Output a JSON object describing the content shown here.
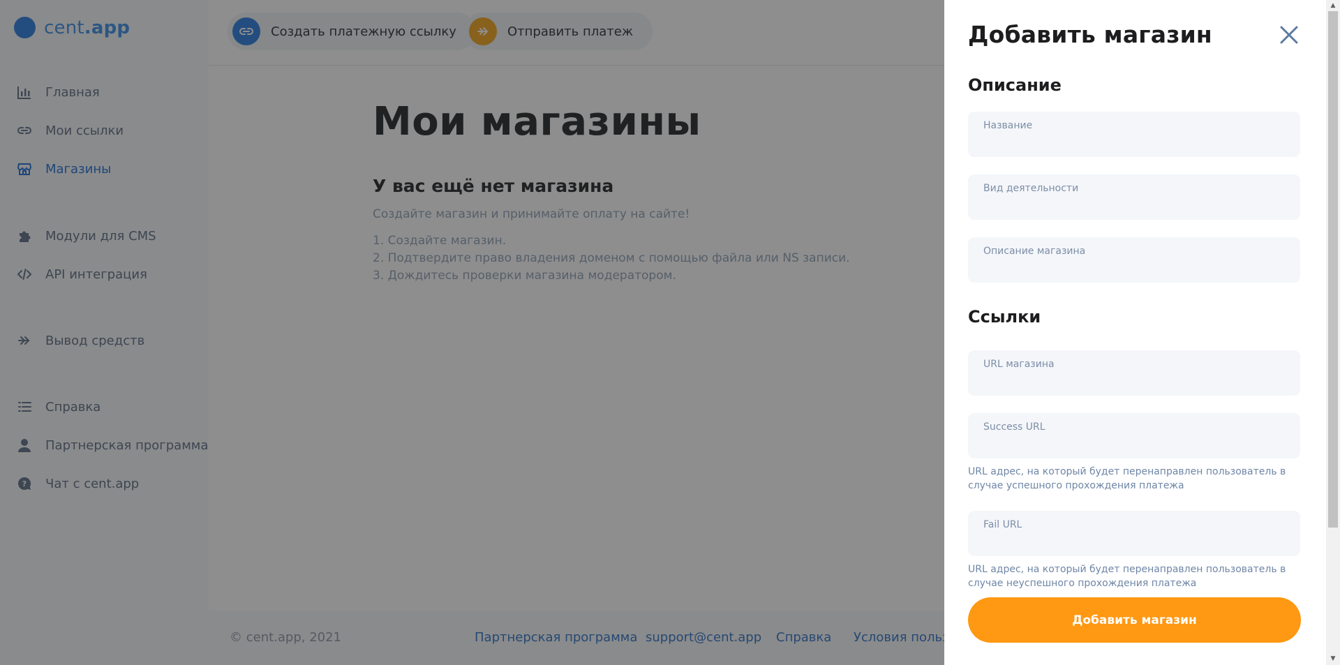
{
  "app": {
    "logo_name": "cent",
    "logo_tld": ".app"
  },
  "sidebar": {
    "items": [
      {
        "label": "Главная",
        "icon": "bar-chart-icon"
      },
      {
        "label": "Мои ссылки",
        "icon": "link-icon"
      },
      {
        "label": "Магазины",
        "icon": "store-icon",
        "active": true
      },
      {
        "label": "Модули для CMS",
        "icon": "puzzle-icon"
      },
      {
        "label": "API интеграция",
        "icon": "code-icon"
      },
      {
        "label": "Вывод средств",
        "icon": "double-arrow-icon"
      },
      {
        "label": "Справка",
        "icon": "list-icon"
      },
      {
        "label": "Партнерская программа",
        "icon": "user-icon"
      },
      {
        "label": "Чат с cent.app",
        "icon": "help-chat-icon"
      }
    ]
  },
  "topbar": {
    "create_link_label": "Создать платежную ссылку",
    "send_payment_label": "Отправить платеж"
  },
  "main": {
    "title": "Мои магазины",
    "empty_title": "У вас ещё нет магазина",
    "empty_subtitle": "Создайте магазин и принимайте оплату на сайте!",
    "steps": [
      "1. Создайте магазин.",
      "2. Подтвердите право владения доменом с помощью файла или NS записи.",
      "3. Дождитесь проверки магазина модератором."
    ]
  },
  "footer": {
    "copyright": "© cent.app, 2021",
    "links": [
      "Партнерская программа",
      "support@cent.app",
      "Справка",
      "Условия пользо"
    ]
  },
  "drawer": {
    "title": "Добавить магазин",
    "section_description": "Описание",
    "section_links": "Ссылки",
    "fields": {
      "name": {
        "label": "Название",
        "value": ""
      },
      "activity": {
        "label": "Вид деятельности",
        "value": ""
      },
      "description": {
        "label": "Описание магазина",
        "value": ""
      },
      "shop_url": {
        "label": "URL магазина",
        "value": ""
      },
      "success_url": {
        "label": "Success URL",
        "value": "",
        "hint": "URL адрес, на который будет перенаправлен пользователь в случае успешного прохождения платежа"
      },
      "fail_url": {
        "label": "Fail URL",
        "value": "",
        "hint": "URL адрес, на который будет перенаправлен пользователь в случае неуспешного прохождения платежа"
      }
    },
    "submit_label": "Добавить магазин"
  },
  "colors": {
    "accent": "#1f6fd6",
    "logo": "#2a7de1",
    "orange": "#ff9812",
    "link_button": "#2a7de1",
    "send_button": "#f2a41c"
  }
}
